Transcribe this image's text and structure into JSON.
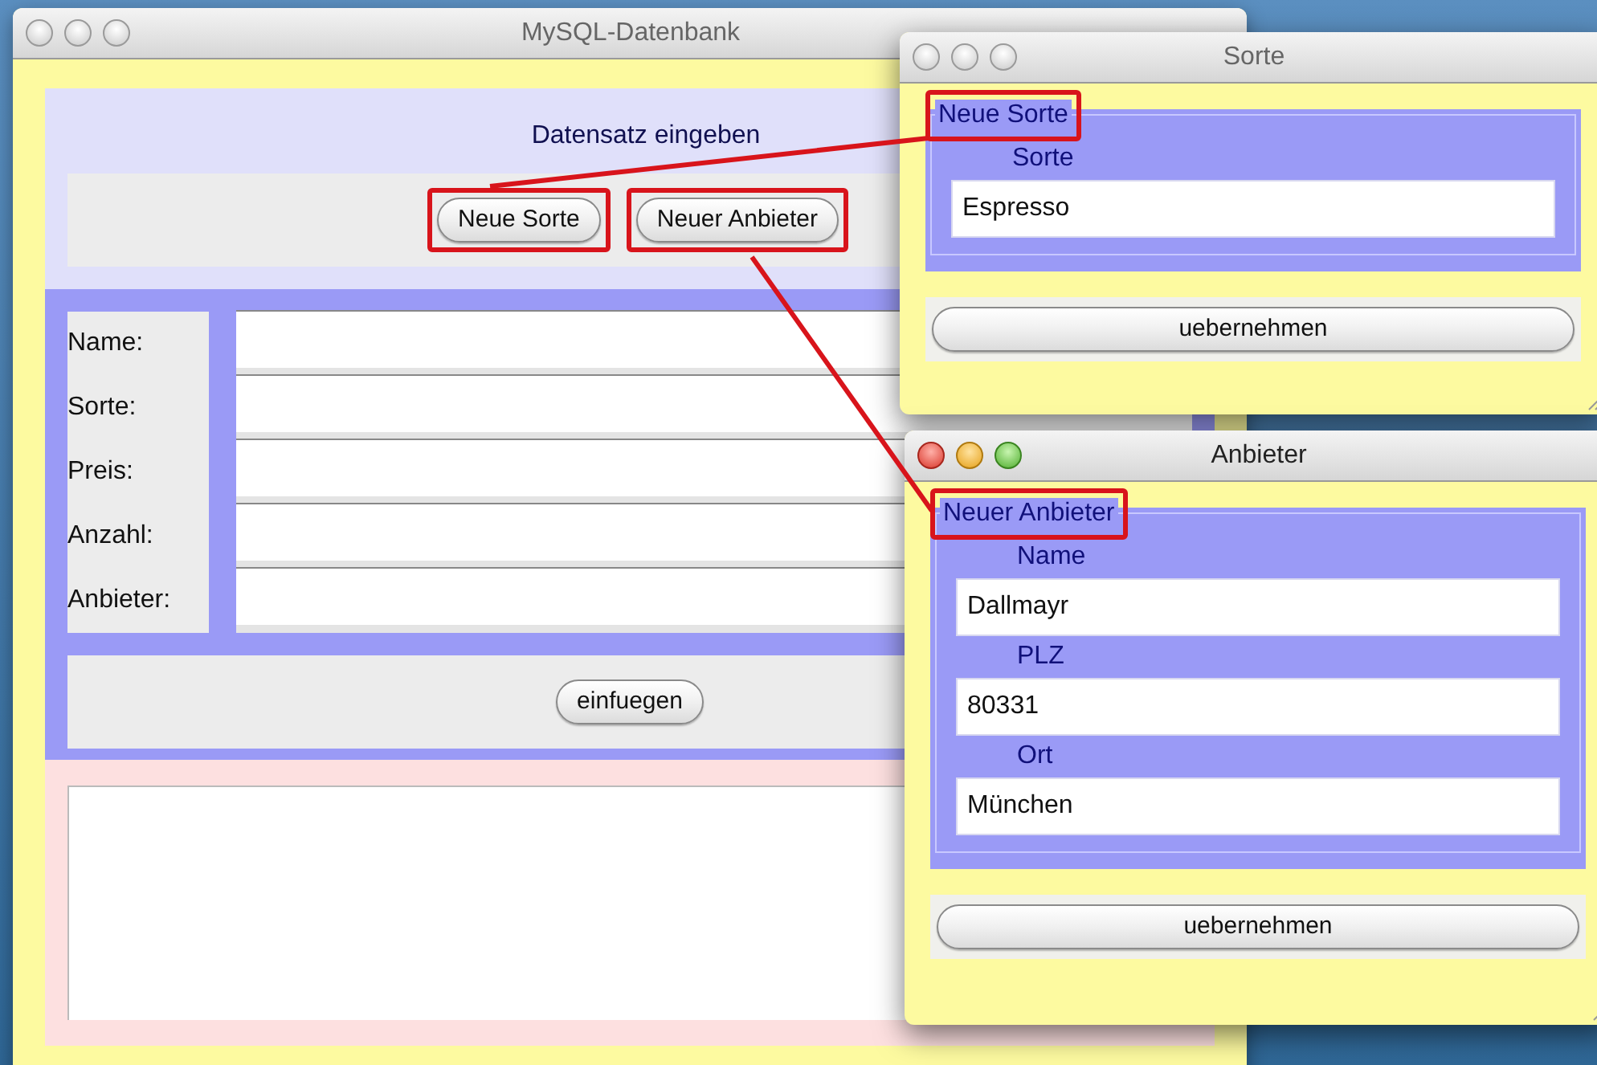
{
  "main_window": {
    "title": "MySQL-Datenbank",
    "active": false,
    "heading": "Datensatz eingeben",
    "buttons": [
      {
        "label": "Neue Sorte",
        "highlighted": true
      },
      {
        "label": "Neuer Anbieter",
        "highlighted": true
      }
    ],
    "fields": [
      {
        "label": "Name:"
      },
      {
        "label": "Sorte:"
      },
      {
        "label": "Preis:"
      },
      {
        "label": "Anzahl:"
      },
      {
        "label": "Anbieter:"
      }
    ],
    "submit_button": "einfuegen"
  },
  "sorte_window": {
    "title": "Sorte",
    "active": false,
    "legend": "Neue Sorte",
    "legend_highlighted": true,
    "fields": [
      {
        "label": "Sorte",
        "value": "Espresso"
      }
    ],
    "button": "uebernehmen"
  },
  "anbieter_window": {
    "title": "Anbieter",
    "active": true,
    "legend": "Neuer Anbieter",
    "legend_highlighted": true,
    "fields": [
      {
        "label": "Name",
        "value": "Dallmayr"
      },
      {
        "label": "PLZ",
        "value": "80331"
      },
      {
        "label": "Ort",
        "value": "München"
      }
    ],
    "button": "uebernehmen"
  }
}
